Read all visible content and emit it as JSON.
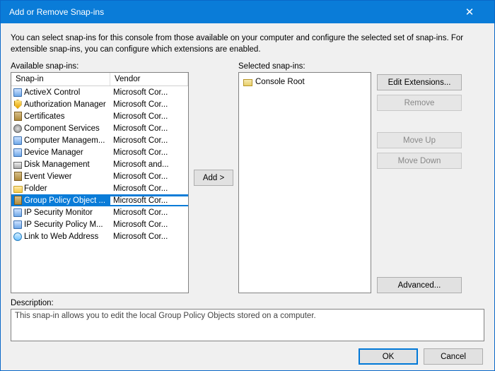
{
  "titlebar": {
    "title": "Add or Remove Snap-ins",
    "close": "✕"
  },
  "intro": "You can select snap-ins for this console from those available on your computer and configure the selected set of snap-ins. For extensible snap-ins, you can configure which extensions are enabled.",
  "labels": {
    "available": "Available snap-ins:",
    "selected": "Selected snap-ins:",
    "description": "Description:"
  },
  "headers": {
    "snapin": "Snap-in",
    "vendor": "Vendor"
  },
  "buttons": {
    "add": "Add >",
    "edit_ext": "Edit Extensions...",
    "remove": "Remove",
    "move_up": "Move Up",
    "move_down": "Move Down",
    "advanced": "Advanced...",
    "ok": "OK",
    "cancel": "Cancel"
  },
  "available": [
    {
      "icon": "gen",
      "name": "ActiveX Control",
      "vendor": "Microsoft Cor..."
    },
    {
      "icon": "shield",
      "name": "Authorization Manager",
      "vendor": "Microsoft Cor..."
    },
    {
      "icon": "book",
      "name": "Certificates",
      "vendor": "Microsoft Cor..."
    },
    {
      "icon": "gear",
      "name": "Component Services",
      "vendor": "Microsoft Cor..."
    },
    {
      "icon": "gen",
      "name": "Computer Managem...",
      "vendor": "Microsoft Cor..."
    },
    {
      "icon": "gen",
      "name": "Device Manager",
      "vendor": "Microsoft Cor..."
    },
    {
      "icon": "disk",
      "name": "Disk Management",
      "vendor": "Microsoft and..."
    },
    {
      "icon": "book",
      "name": "Event Viewer",
      "vendor": "Microsoft Cor..."
    },
    {
      "icon": "folder",
      "name": "Folder",
      "vendor": "Microsoft Cor..."
    },
    {
      "icon": "book",
      "name": "Group Policy Object ...",
      "vendor": "Microsoft Cor...",
      "selected": true
    },
    {
      "icon": "gen",
      "name": "IP Security Monitor",
      "vendor": "Microsoft Cor..."
    },
    {
      "icon": "gen",
      "name": "IP Security Policy M...",
      "vendor": "Microsoft Cor..."
    },
    {
      "icon": "link",
      "name": "Link to Web Address",
      "vendor": "Microsoft Cor..."
    }
  ],
  "selected_tree": {
    "root": "Console Root"
  },
  "description_text": "This snap-in allows you to edit the local Group Policy Objects stored on a computer.",
  "button_state": {
    "edit_ext": "enabled",
    "remove": "disabled",
    "move_up": "disabled",
    "move_down": "disabled",
    "advanced": "enabled"
  }
}
